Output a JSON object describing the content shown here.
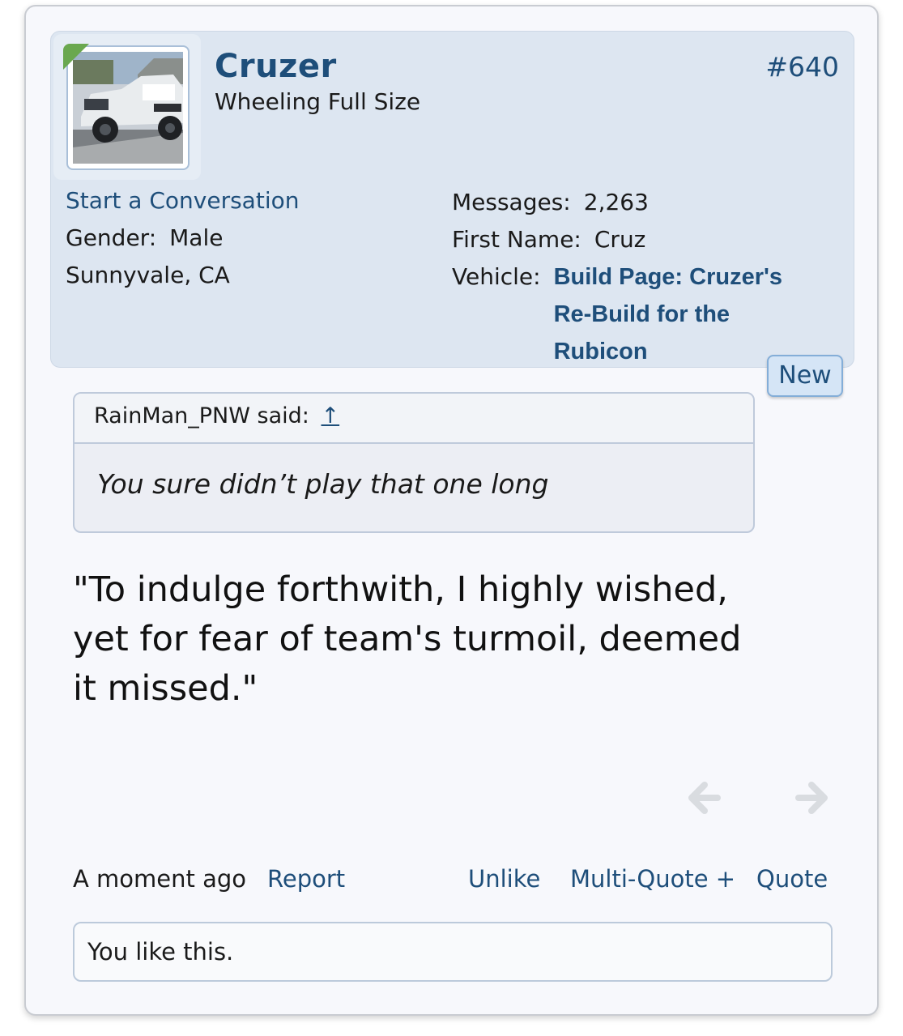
{
  "user": {
    "username": "Cruzer",
    "title": "Wheeling Full Size",
    "start_conversation": "Start a Conversation",
    "gender_label": "Gender:",
    "gender_value": "Male",
    "location": "Sunnyvale, CA",
    "messages_label": "Messages:",
    "messages_value": "2,263",
    "first_name_label": "First Name:",
    "first_name_value": "Cruz",
    "vehicle_label": "Vehicle:",
    "vehicle_value": "Build Page: Cruzer's Re-Build for the Rubicon"
  },
  "post": {
    "number": "#640",
    "new_badge": "New",
    "quote_author": "RainMan_PNW said:",
    "quote_arrow": "↑",
    "quote_text": "You sure didn’t play that one long",
    "message": "\"To indulge forthwith, I highly wished, yet for fear of team's turmoil, deemed it missed.\"",
    "date": "A moment ago",
    "report": "Report",
    "unlike": "Unlike",
    "multi_quote": "Multi-Quote +",
    "quote": "Quote",
    "likes_text": "You like this."
  },
  "icons": {
    "prev": "arrow-left-icon",
    "next": "arrow-right-icon"
  },
  "colors": {
    "link": "#1e4e7a",
    "user_panel_bg": "#dde6f1",
    "online_indicator": "#6aa84f"
  }
}
